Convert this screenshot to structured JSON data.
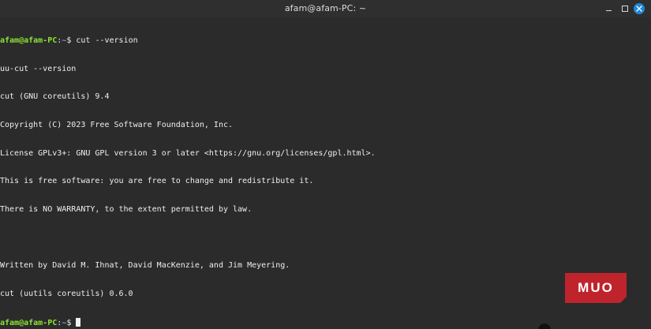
{
  "window": {
    "title": "afam@afam-PC: ~",
    "minimize_label": "minimize",
    "maximize_label": "maximize",
    "close_label": "close"
  },
  "terminal": {
    "lines": [
      {
        "type": "prompt",
        "user_host": "afam@afam-PC",
        "path": "~",
        "symbol": "$",
        "command": " cut --version"
      },
      {
        "type": "output",
        "text": "uu-cut --version"
      },
      {
        "type": "output",
        "text": "cut (GNU coreutils) 9.4"
      },
      {
        "type": "output",
        "text": "Copyright (C) 2023 Free Software Foundation, Inc."
      },
      {
        "type": "output",
        "text": "License GPLv3+: GNU GPL version 3 or later <https://gnu.org/licenses/gpl.html>."
      },
      {
        "type": "output",
        "text": "This is free software: you are free to change and redistribute it."
      },
      {
        "type": "output",
        "text": "There is NO WARRANTY, to the extent permitted by law."
      },
      {
        "type": "output",
        "text": ""
      },
      {
        "type": "output",
        "text": "Written by David M. Ihnat, David MacKenzie, and Jim Meyering."
      },
      {
        "type": "output",
        "text": "cut (uutils coreutils) 0.6.0"
      },
      {
        "type": "prompt",
        "user_host": "afam@afam-PC",
        "path": "~",
        "symbol": "$",
        "command": " "
      }
    ]
  },
  "watermark": {
    "text": "MUO",
    "color": "#d9232e"
  },
  "colors": {
    "prompt_green": "#8ae234",
    "terminal_bg": "#2b2b2b",
    "close_button_blue": "#1e87d9"
  }
}
